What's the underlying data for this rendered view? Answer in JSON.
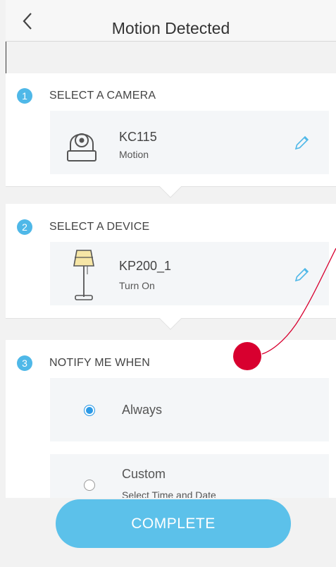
{
  "header": {
    "title": "Motion Detected",
    "back_icon": "chevron-left-icon"
  },
  "sections": [
    {
      "number": "1",
      "title": "SELECT A CAMERA",
      "card": {
        "icon": "camera-icon",
        "name": "KC115",
        "sub": "Motion",
        "action_icon": "pencil-icon"
      }
    },
    {
      "number": "2",
      "title": "SELECT A DEVICE",
      "card": {
        "icon": "floor-lamp-icon",
        "name": "KP200_1",
        "sub": "Turn On",
        "action_icon": "pencil-icon"
      }
    },
    {
      "number": "3",
      "title": "NOTIFY ME WHEN",
      "options": [
        {
          "label": "Always",
          "selected": true
        },
        {
          "label": "Custom",
          "sub": "Select Time and Date",
          "selected": false
        }
      ]
    }
  ],
  "complete_button": "COMPLETE",
  "colors": {
    "accent": "#4fb8e8",
    "button": "#5cc1ea",
    "touch_indicator": "#d8002f"
  }
}
